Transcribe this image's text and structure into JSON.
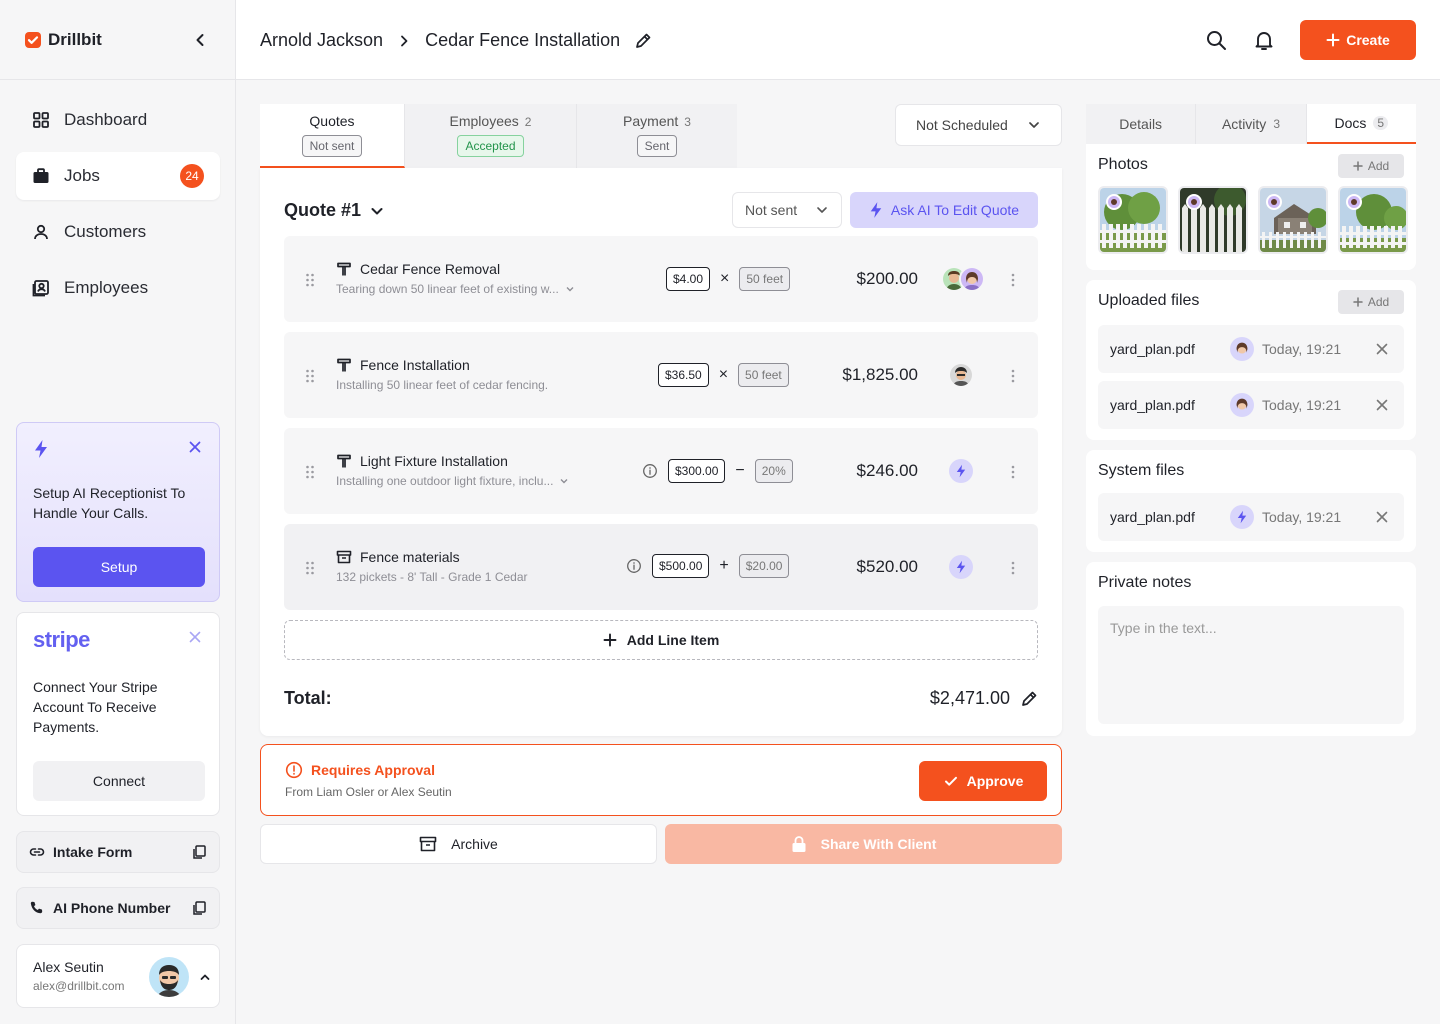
{
  "brand": {
    "name": "Drillbit",
    "accent": "#f4511e",
    "ai_color": "#5b54f0"
  },
  "nav": [
    {
      "label": "Dashboard",
      "icon": "grid-icon"
    },
    {
      "label": "Jobs",
      "icon": "briefcase-icon",
      "badge": "24",
      "active": true
    },
    {
      "label": "Customers",
      "icon": "user-icon"
    },
    {
      "label": "Employees",
      "icon": "id-card-icon"
    }
  ],
  "ai_card": {
    "text": "Setup AI Receptionist To Handle Your Calls.",
    "button": "Setup"
  },
  "stripe_card": {
    "logo": "stripe",
    "text": "Connect Your Stripe Account To Receive Payments.",
    "button": "Connect"
  },
  "links": {
    "intake": "Intake Form",
    "phone": "AI Phone Number"
  },
  "user": {
    "name": "Alex Seutin",
    "email": "alex@drillbit.com"
  },
  "header": {
    "customer": "Arnold Jackson",
    "job": "Cedar Fence Installation",
    "create_label": "Create"
  },
  "tabs": [
    {
      "label": "Quotes",
      "count": "",
      "status": "Not sent"
    },
    {
      "label": "Employees",
      "count": "2",
      "status": "Accepted"
    },
    {
      "label": "Payment",
      "count": "3",
      "status": "Sent"
    }
  ],
  "schedule": {
    "value": "Not Scheduled"
  },
  "quote": {
    "title": "Quote #1",
    "status": "Not sent",
    "ai_button": "Ask AI To Edit Quote",
    "items": [
      {
        "title": "Cedar Fence Removal",
        "desc": "Tearing down 50 linear feet of existing w...",
        "price": "$4.00",
        "op": "×",
        "qty": "50 feet",
        "amount": "$200.00"
      },
      {
        "title": "Fence Installation",
        "desc": "Installing 50 linear feet of cedar fencing.",
        "price": "$36.50",
        "op": "×",
        "qty": "50 feet",
        "amount": "$1,825.00"
      },
      {
        "title": "Light Fixture Installation",
        "desc": "Installing one outdoor light fixture, inclu...",
        "price": "$300.00",
        "op": "−",
        "qty": "20%",
        "amount": "$246.00"
      },
      {
        "title": "Fence materials",
        "desc": "132 pickets - 8' Tall - Grade 1 Cedar",
        "price": "$500.00",
        "op": "+",
        "qty": "$20.00",
        "amount": "$520.00"
      }
    ],
    "add_line": "Add Line Item",
    "total_label": "Total:",
    "total_value": "$2,471.00"
  },
  "approval": {
    "title": "Requires Approval",
    "subtitle": "From Liam Osler or Alex Seutin",
    "button": "Approve"
  },
  "actions": {
    "archive": "Archive",
    "share": "Share With Client"
  },
  "right_tabs": [
    {
      "label": "Details",
      "count": ""
    },
    {
      "label": "Activity",
      "count": "3"
    },
    {
      "label": "Docs",
      "count": "5"
    }
  ],
  "photos": {
    "title": "Photos",
    "add": "Add"
  },
  "uploaded": {
    "title": "Uploaded files",
    "add": "Add",
    "files": [
      {
        "name": "yard_plan.pdf",
        "time": "Today, 19:21"
      },
      {
        "name": "yard_plan.pdf",
        "time": "Today, 19:21"
      }
    ]
  },
  "system": {
    "title": "System files",
    "files": [
      {
        "name": "yard_plan.pdf",
        "time": "Today, 19:21"
      }
    ]
  },
  "notes": {
    "title": "Private notes",
    "placeholder": "Type in the text..."
  }
}
